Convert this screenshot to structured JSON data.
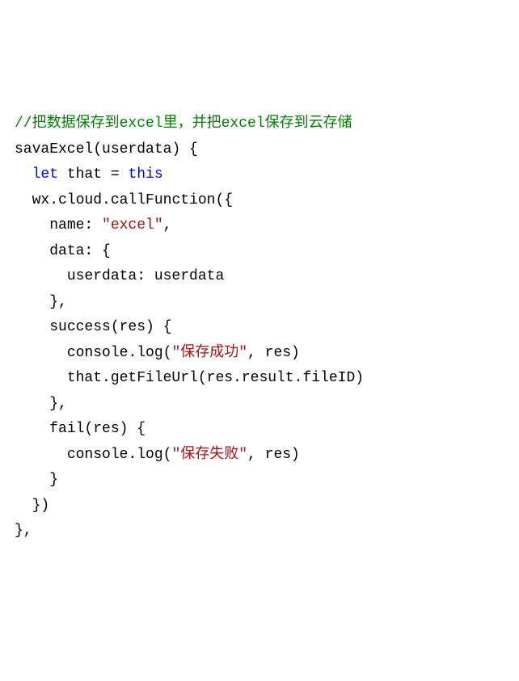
{
  "code": {
    "line1_comment": "//把数据保存到excel里，并把excel保存到云存储",
    "line2_func": "savaExcel",
    "line2_param": "userdata",
    "line3_let": "let",
    "line3_that": " that = ",
    "line3_this": "this",
    "line4_wx": "wx.cloud.callFunction({",
    "line5_name": "name: ",
    "line5_val": "\"excel\"",
    "line6_data": "data: {",
    "line7_userdata": "userdata: userdata",
    "line8_close": "},",
    "line9_success": "success(res) {",
    "line10_console": "console.log(",
    "line10_str": "\"保存成功\"",
    "line10_rest": ", res)",
    "line11_that": "that.getFileUrl(res.result.fileID)",
    "line12_close": "},",
    "line13_fail": "fail(res) {",
    "line14_console": "console.log(",
    "line14_str": "\"保存失败\"",
    "line14_rest": ", res)",
    "line15_close": "}",
    "line16_close": "})",
    "line17_close": "},"
  }
}
